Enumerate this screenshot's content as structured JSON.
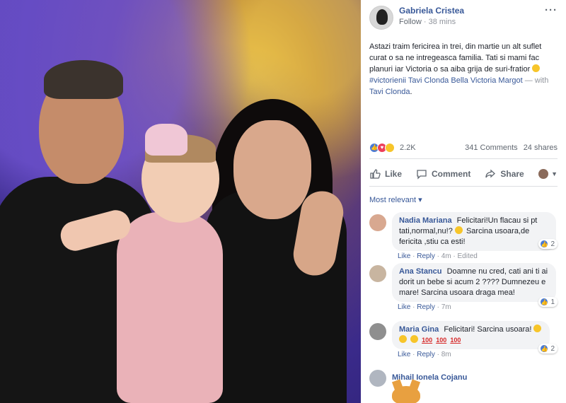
{
  "post": {
    "author": "Gabriela Cristea",
    "follow_label": "Follow",
    "time": "38 mins",
    "more_label": "···",
    "text_main": "Astazi traim fericirea in trei, din martie un alt suflet curat o sa ne intregeasca familia. Tati si mami fac planuri iar Victoria o sa aiba grija de suri-fratior",
    "hashtag": "#victorienii",
    "tagged1": "Tavi Clonda",
    "tagged2": "Bella Victoria Margot",
    "with_label": "— with",
    "tagged3": "Tavi Clonda",
    "period": "."
  },
  "stats": {
    "reactions": "2.2K",
    "comments": "341 Comments",
    "shares": "24 shares"
  },
  "actions": {
    "like": "Like",
    "comment": "Comment",
    "share": "Share"
  },
  "sort_label": "Most relevant ▾",
  "comments": [
    {
      "name": "Nadia Mariana",
      "text": "Felicitari!Un flacau si pt tati,normal,nu!?",
      "text2": "Sarcina usoara,de fericita ,stiu ca esti!",
      "like": "Like",
      "reply": "Reply",
      "time": "4m",
      "edited": "Edited",
      "count": "2"
    },
    {
      "name": "Ana Stancu",
      "text": "Doamne nu cred, cati ani ti ai dorit un bebe si acum 2 ???? Dumnezeu e mare! Sarcina usoara draga mea!",
      "like": "Like",
      "reply": "Reply",
      "time": "7m",
      "count": "1"
    },
    {
      "name": "Maria Gina",
      "text": "Felicitari! Sarcina usoara!",
      "hundreds": [
        "100",
        "100",
        "100"
      ],
      "like": "Like",
      "reply": "Reply",
      "time": "8m",
      "count": "2"
    },
    {
      "name": "Mihail Ionela Cojanu"
    }
  ],
  "colors": {
    "link": "#385898",
    "like_blue": "#4a7bd6",
    "love_red": "#ed3e5a",
    "wow_yellow": "#f7c52a"
  }
}
